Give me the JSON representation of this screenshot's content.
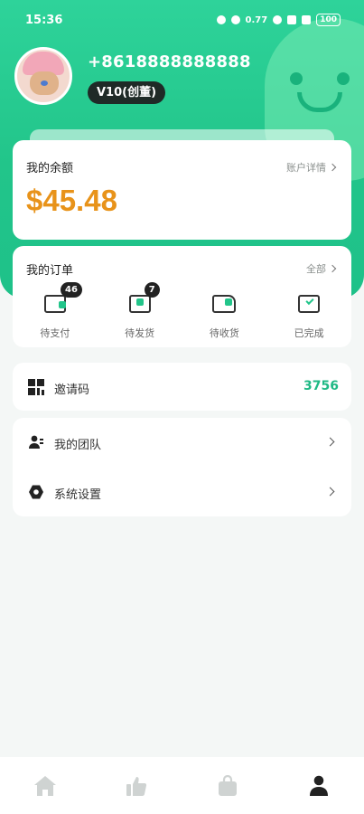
{
  "status_bar": {
    "time": "15:36",
    "network_speed": "0.77",
    "battery": "100"
  },
  "profile": {
    "phone": "+8618888888888",
    "level": "V10(创董)"
  },
  "balance": {
    "title": "我的余额",
    "link_label": "账户详情",
    "value": "$45.48"
  },
  "orders": {
    "title": "我的订单",
    "link_label": "全部",
    "items": [
      {
        "label": "待支付",
        "badge": "46",
        "icon": "wallet-icon"
      },
      {
        "label": "待发货",
        "badge": "7",
        "icon": "box-icon"
      },
      {
        "label": "待收货",
        "badge": "",
        "icon": "truck-icon"
      },
      {
        "label": "已完成",
        "badge": "",
        "icon": "completed-tray-icon"
      }
    ]
  },
  "invite": {
    "label": "邀请码",
    "code": "3756"
  },
  "menu": {
    "items": [
      {
        "label": "我的团队",
        "icon": "team-icon"
      },
      {
        "label": "系统设置",
        "icon": "settings-icon"
      }
    ]
  },
  "tabbar": {
    "items": [
      {
        "icon": "home-icon",
        "active": false
      },
      {
        "icon": "thumbs-up-icon",
        "active": false
      },
      {
        "icon": "shopping-bag-icon",
        "active": false
      },
      {
        "icon": "profile-icon",
        "active": true
      }
    ]
  },
  "colors": {
    "accent": "#22c58a",
    "balance": "#e8931a",
    "invite_code": "#1fb985"
  }
}
